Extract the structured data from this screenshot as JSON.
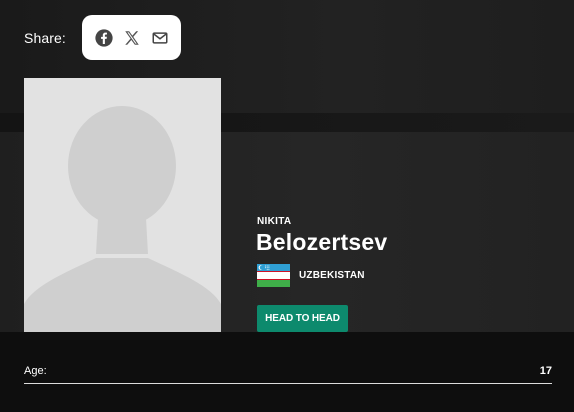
{
  "share": {
    "label": "Share:",
    "icons": [
      "facebook-icon",
      "x-icon",
      "email-icon"
    ]
  },
  "athlete": {
    "first_name": "NIKITA",
    "last_name": "Belozertsev",
    "country": "UZBEKISTAN",
    "flag": "uzbekistan-flag"
  },
  "actions": {
    "head_to_head_label": "HEAD TO HEAD"
  },
  "stats": {
    "age_label": "Age:",
    "age_value": "17"
  },
  "colors": {
    "accent_button": "#0d8a6d",
    "share_box_bg": "#ffffff",
    "portrait_bg": "#e2e2e2",
    "silhouette": "#cfcfcf"
  }
}
